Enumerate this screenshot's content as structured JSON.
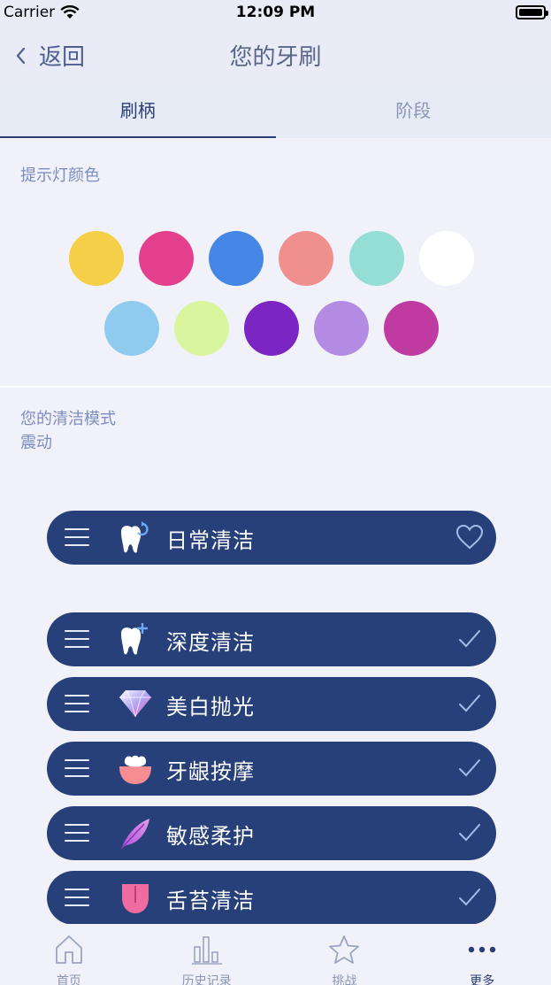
{
  "status_bar": {
    "carrier": "Carrier",
    "time": "12:09 PM"
  },
  "nav": {
    "back_label": "返回",
    "title": "您的牙刷"
  },
  "tabs": [
    {
      "label": "刷柄",
      "active": true
    },
    {
      "label": "阶段",
      "active": false
    }
  ],
  "indicator": {
    "label": "提示灯颜色",
    "colors": [
      "#f5cf48",
      "#e43f8c",
      "#4686e4",
      "#f0908e",
      "#95ded6",
      "#ffffff",
      "#8ecbef",
      "#d9f69f",
      "#7b25c2",
      "#b48be2",
      "#c03ba1"
    ]
  },
  "cleaning": {
    "title": "您的清洁模式",
    "subtitle": "震动",
    "favorite": {
      "label": "日常清洁",
      "icon": "tooth-refresh-icon",
      "action_icon": "heart-icon"
    },
    "modes": [
      {
        "label": "深度清洁",
        "icon": "tooth-plus-icon"
      },
      {
        "label": "美白抛光",
        "icon": "diamond-icon"
      },
      {
        "label": "牙龈按摩",
        "icon": "gum-icon"
      },
      {
        "label": "敏感柔护",
        "icon": "feather-icon"
      },
      {
        "label": "舌苔清洁",
        "icon": "tongue-icon"
      }
    ]
  },
  "tab_bar": [
    {
      "label": "首页",
      "icon": "home-icon"
    },
    {
      "label": "历史记录",
      "icon": "bar-chart-icon"
    },
    {
      "label": "挑战",
      "icon": "star-icon"
    },
    {
      "label": "更多",
      "icon": "more-dots-icon",
      "active": true
    }
  ]
}
